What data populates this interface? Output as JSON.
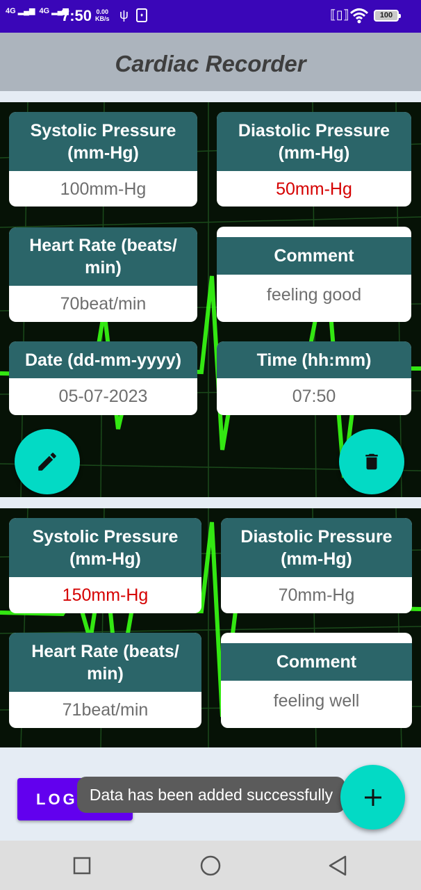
{
  "status_bar": {
    "network_1": "4G",
    "network_2": "4G",
    "time": "7:50",
    "speed_value": "0.00",
    "speed_unit": "KB/s",
    "usb_icon": "usb-icon",
    "vibrate_icon": "vibrate-icon",
    "wifi_icon": "wifi-icon",
    "battery": "100"
  },
  "app_bar": {
    "title": "Cardiac Recorder"
  },
  "records": [
    {
      "systolic_label": "Systolic Pressure (mm-Hg)",
      "systolic_value": "100mm-Hg",
      "diastolic_label": "Diastolic Pressure (mm-Hg)",
      "diastolic_value": "50mm-Hg",
      "heart_rate_label": "Heart Rate (beats/ min)",
      "heart_rate_value": "70beat/min",
      "comment_label": "Comment",
      "comment_value": "feeling good",
      "date_label": "Date (dd-mm-yyyy)",
      "date_value": "05-07-2023",
      "time_label": "Time (hh:mm)",
      "time_value": "07:50",
      "edit_icon": "pencil-icon",
      "delete_icon": "trash-icon"
    },
    {
      "systolic_label": "Systolic Pressure (mm-Hg)",
      "systolic_value": "150mm-Hg",
      "diastolic_label": "Diastolic Pressure (mm-Hg)",
      "diastolic_value": "70mm-Hg",
      "heart_rate_label": "Heart Rate (beats/ min)",
      "heart_rate_value": "71beat/min",
      "comment_label": "Comment",
      "comment_value": "feeling well"
    }
  ],
  "colors": {
    "status_bar": "#3a06b8",
    "app_bar": "#acb4bd",
    "card_header": "#2b6569",
    "abnormal_value": "#d50000",
    "fab": "#03dac5",
    "logout_button": "#6200ee"
  },
  "logout_button": {
    "label": "LOG OUT"
  },
  "toast": {
    "message": "Data has been added successfully"
  },
  "add_button": {
    "icon": "plus-icon"
  },
  "nav_bar": {
    "recents_icon": "square-icon",
    "home_icon": "circle-icon",
    "back_icon": "triangle-back-icon"
  }
}
